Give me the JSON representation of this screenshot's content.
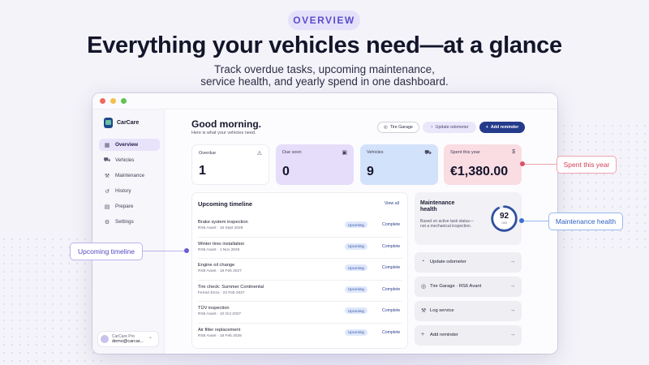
{
  "hero": {
    "pill": "OVERVIEW",
    "headline": "Everything your vehicles need—at a glance",
    "subline_1": "Track overdue tasks, upcoming maintenance,",
    "subline_2": "service health, and yearly spend in one dashboard."
  },
  "colors": {
    "accent": "#243b8c",
    "pill": "#5a4ec9",
    "spent": "#d34058",
    "health": "#2f5fc2",
    "timeline": "#5548c3"
  },
  "sidebar": {
    "app_name": "CarCare",
    "items": [
      {
        "label": "Overview",
        "icon": "grid-icon",
        "active": true
      },
      {
        "label": "Vehicles",
        "icon": "car-icon"
      },
      {
        "label": "Maintenance",
        "icon": "wrench-icon"
      },
      {
        "label": "History",
        "icon": "history-icon"
      },
      {
        "label": "Prepare",
        "icon": "clipboard-icon"
      },
      {
        "label": "Settings",
        "icon": "gear-icon"
      }
    ],
    "user": {
      "plan": "CarCare Pro",
      "email": "demo@carcar..."
    }
  },
  "header": {
    "greeting": "Good morning.",
    "subtitle": "Here is what your vehicles need.",
    "buttons": {
      "garage": "Tire Garage",
      "odometer": "Update odometer",
      "add": "Add reminder"
    }
  },
  "stats": [
    {
      "label": "Overdue",
      "value": "1",
      "icon": "warning-icon"
    },
    {
      "label": "Due soon",
      "value": "0",
      "icon": "calendar-icon"
    },
    {
      "label": "Vehicles",
      "value": "9",
      "icon": "car-icon"
    },
    {
      "label": "Spent this year",
      "value": "€1,380.00",
      "icon": "coin-icon"
    }
  ],
  "timeline": {
    "title": "Upcoming timeline",
    "view_all": "View all",
    "rows": [
      {
        "name": "Brake system inspection",
        "sub": "RS6 Avant · 15 Sept 2026",
        "badge": "Upcoming",
        "action": "Complete"
      },
      {
        "name": "Winter tires installation",
        "sub": "RS6 Avant · 1 Nov 2026",
        "badge": "Upcoming",
        "action": "Complete"
      },
      {
        "name": "Engine oil change",
        "sub": "RS6 Avant · 18 Feb 2027",
        "badge": "Upcoming",
        "action": "Complete"
      },
      {
        "name": "Tire check: Summer Continental",
        "sub": "Ferrari Enzo · 22 Feb 2027",
        "badge": "Upcoming",
        "action": "Complete"
      },
      {
        "name": "TÜV inspection",
        "sub": "RS6 Avant · 10 Oct 2027",
        "badge": "Upcoming",
        "action": "Complete"
      },
      {
        "name": "Air filter replacement",
        "sub": "RS6 Avant · 18 Feb 2028",
        "badge": "Upcoming",
        "action": "Complete"
      }
    ]
  },
  "health": {
    "title": "Maintenance health",
    "subtitle": "Based on active task status—not a mechanical inspection.",
    "score": "92",
    "score_fraction": 0.92,
    "unit": "/100"
  },
  "quick_actions": [
    {
      "label": "Update odometer",
      "icon": "gauge-icon"
    },
    {
      "label": "Tire Garage · RS6 Avant",
      "icon": "tire-icon"
    },
    {
      "label": "Log service",
      "icon": "wrench-icon"
    },
    {
      "label": "Add reminder",
      "icon": "plus-icon"
    }
  ],
  "callouts": {
    "spent": "Spent this year",
    "health": "Maintenance health",
    "timeline": "Upcoming timeline"
  }
}
